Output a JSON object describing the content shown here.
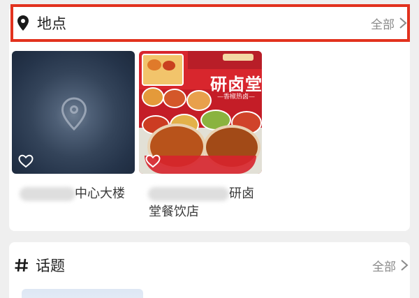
{
  "places": {
    "title": "地点",
    "more_label": "全部",
    "items": [
      {
        "caption": "中心大楼",
        "image": "location-placeholder"
      },
      {
        "caption_line1": "研卤",
        "caption_line2": "堂餐饮店",
        "image": "food-photo",
        "brand_title": "研卤堂",
        "brand_subtitle": "—香椒热卤—"
      }
    ]
  },
  "topics": {
    "title": "话题",
    "more_label": "全部"
  },
  "colors": {
    "highlight_border": "#e2321e",
    "poster_red": "#d8262d"
  }
}
